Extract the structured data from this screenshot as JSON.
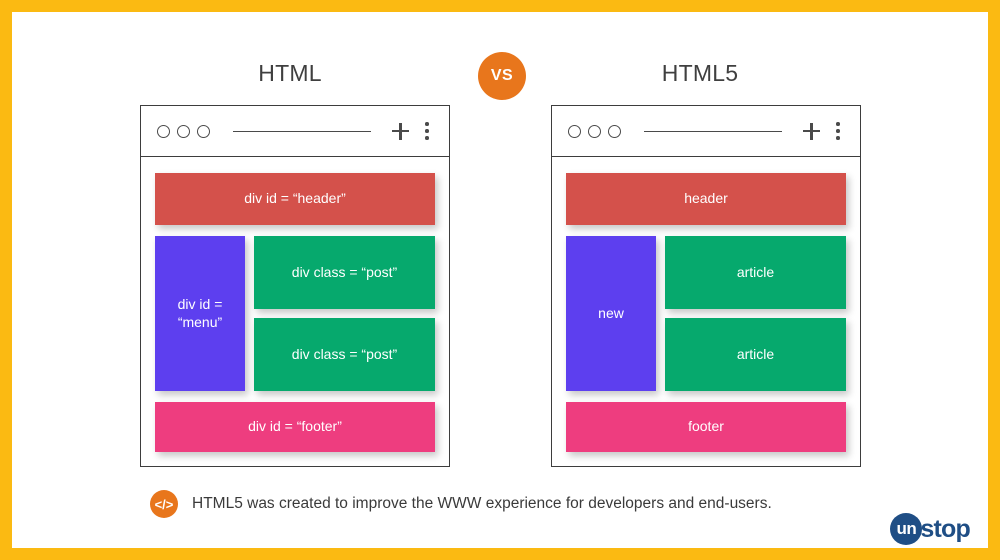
{
  "frame": {
    "border_color": "#fbba12"
  },
  "headings": {
    "left": "HTML",
    "right": "HTML5"
  },
  "vs_badge": {
    "label": "VS",
    "color": "#e8761c"
  },
  "browser_chrome": {
    "plus_icon": "plus-icon",
    "menu_icon": "kebab-menu-icon",
    "dot_count": 3
  },
  "palette": {
    "header": "#d4514b",
    "menu": "#5d3fef",
    "post": "#06a96d",
    "footer": "#ee3d7f"
  },
  "panels": {
    "left": {
      "header": "div id = “header”",
      "menu": "div id =\n“menu”",
      "menu_line1": "div id =",
      "menu_line2": "“menu”",
      "post1": "div class = “post”",
      "post2": "div class = “post”",
      "footer": "div id = “footer”"
    },
    "right": {
      "header": "header",
      "menu": "new",
      "post1": "article",
      "post2": "article",
      "footer": "footer"
    }
  },
  "caption": {
    "icon": "code-icon",
    "icon_glyph": "</>",
    "text": "HTML5 was created to improve the WWW experience for developers and end-users."
  },
  "logo": {
    "mark": "un",
    "text": "stop",
    "color": "#1f4e85"
  }
}
